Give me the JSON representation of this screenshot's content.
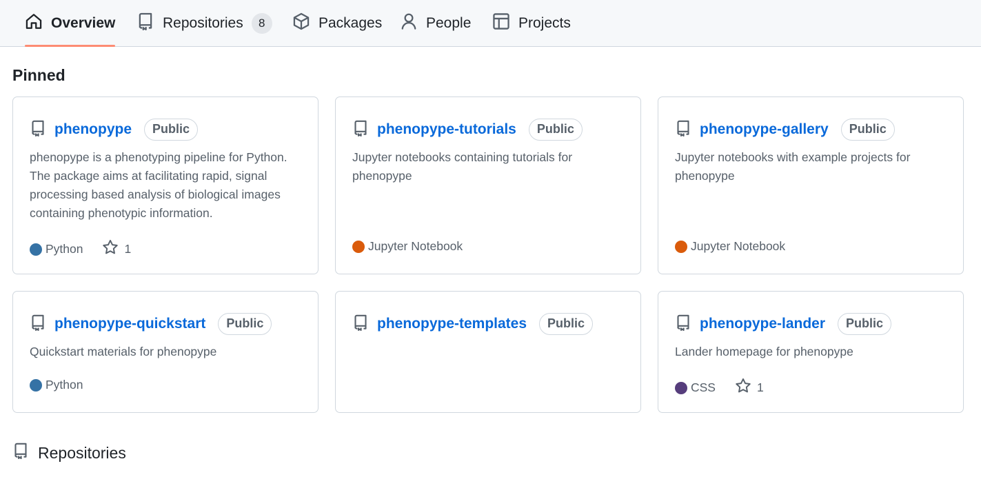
{
  "nav": {
    "tabs": [
      {
        "label": "Overview",
        "icon": "home-icon",
        "active": true
      },
      {
        "label": "Repositories",
        "icon": "repo-icon",
        "count": "8"
      },
      {
        "label": "Packages",
        "icon": "package-icon"
      },
      {
        "label": "People",
        "icon": "person-icon"
      },
      {
        "label": "Projects",
        "icon": "table-icon"
      }
    ]
  },
  "pinned": {
    "title": "Pinned",
    "cards": [
      {
        "name": "phenopype",
        "visibility": "Public",
        "description": "phenopype is a phenotyping pipeline for Python. The package aims at facilitating rapid, signal processing based analysis of biological images containing phenotypic information.",
        "language": "Python",
        "language_color": "#3572A5",
        "stars": "1"
      },
      {
        "name": "phenopype-tutorials",
        "visibility": "Public",
        "description": "Jupyter notebooks containing tutorials for phenopype",
        "language": "Jupyter Notebook",
        "language_color": "#DA5B0B"
      },
      {
        "name": "phenopype-gallery",
        "visibility": "Public",
        "description": "Jupyter notebooks with example projects for phenopype",
        "language": "Jupyter Notebook",
        "language_color": "#DA5B0B"
      },
      {
        "name": "phenopype-quickstart",
        "visibility": "Public",
        "description": "Quickstart materials for phenopype",
        "language": "Python",
        "language_color": "#3572A5"
      },
      {
        "name": "phenopype-templates",
        "visibility": "Public"
      },
      {
        "name": "phenopype-lander",
        "visibility": "Public",
        "description": "Lander homepage for phenopype",
        "language": "CSS",
        "language_color": "#563d7c",
        "stars": "1"
      }
    ]
  },
  "repositories": {
    "title": "Repositories"
  },
  "colors": {
    "accent_underline": "#fd8c73",
    "link": "#0969da",
    "border": "#d0d7de"
  }
}
